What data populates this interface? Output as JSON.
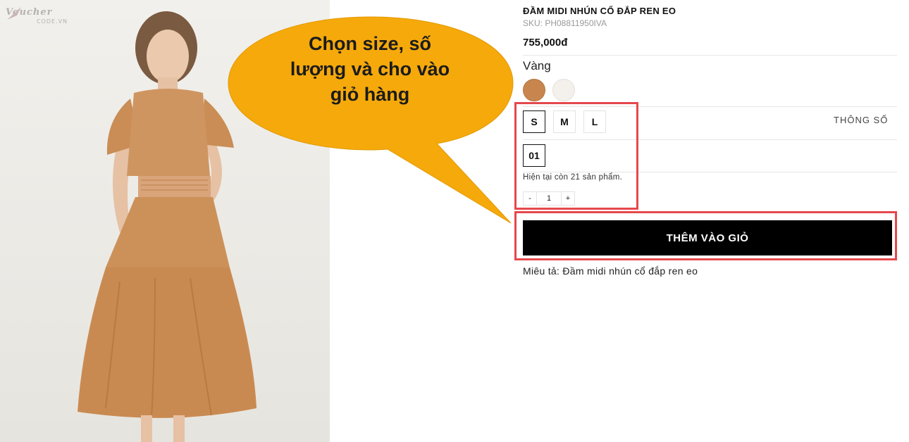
{
  "watermark": {
    "brand": "Voucher",
    "domain": "CODE.VN"
  },
  "callout": {
    "lines": [
      "Chọn size, số",
      "lượng và cho vào",
      "giỏ hàng"
    ],
    "fill": "#f5a90b"
  },
  "product": {
    "title": "ĐẦM MIDI NHÚN CỔ ĐẮP REN EO",
    "sku": "SKU: PH08811950IVA",
    "price": "755,000đ",
    "color_label": "Vàng",
    "swatches": [
      {
        "name": "caramel",
        "hex": "#c8864e",
        "selected": true
      },
      {
        "name": "cream",
        "hex": "#f4f0ec",
        "selected": false
      }
    ],
    "sizes": [
      {
        "label": "S",
        "selected": true
      },
      {
        "label": "M",
        "selected": false
      },
      {
        "label": "L",
        "selected": false
      }
    ],
    "size_chart_link": "THÔNG SỐ",
    "variant": "01",
    "stock_text": "Hiện tại còn 21 sản phẩm.",
    "quantity": {
      "minus": "-",
      "value": "1",
      "plus": "+"
    },
    "add_to_cart": "THÊM VÀO GIỎ",
    "description": "Miêu tả: Đầm midi nhún cổ đắp ren eo"
  },
  "highlight_color": "#e5484d"
}
